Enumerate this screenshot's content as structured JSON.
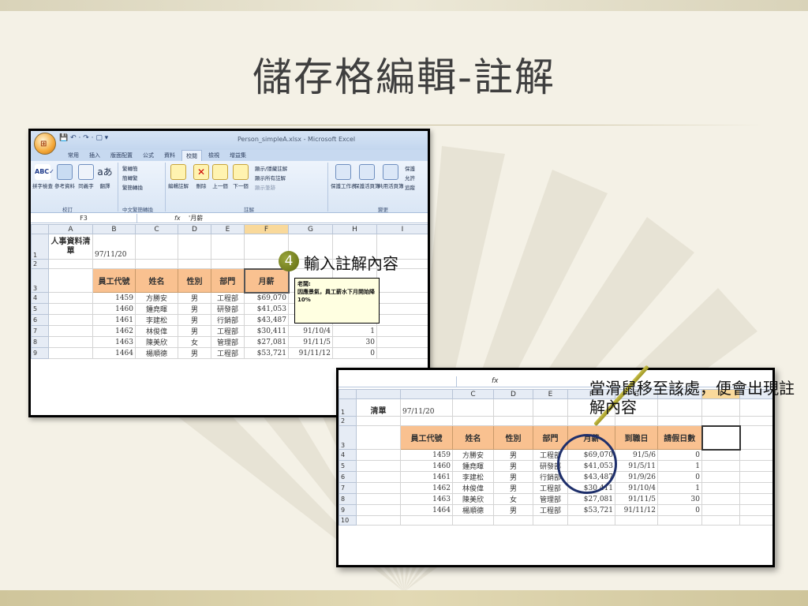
{
  "slide": {
    "title": "儲存格編輯-註解",
    "step_number": "4",
    "step_text": "輸入註解內容",
    "callout_text": "當滑鼠移至該處，便會出現註解內容"
  },
  "excel1": {
    "window_title": "Person_simpleA.xlsx - Microsoft Excel",
    "tabs": [
      "常用",
      "插入",
      "版面配置",
      "公式",
      "資料",
      "校閱",
      "檢視",
      "增益集"
    ],
    "active_tab": "校閱",
    "ribbon": {
      "spelling": "拼字檢查",
      "research": "參考資料",
      "thesaurus": "同義字",
      "translate": "翻譯",
      "trad_to_simp": "繁轉簡",
      "simp_to_trad": "簡轉繁",
      "convert": "繁簡轉換",
      "new_comment": "編輯註解",
      "delete": "刪除",
      "previous": "上一個",
      "next": "下一個",
      "show_hide": "顯示/隱藏註解",
      "show_all": "顯示所有註解",
      "show_ink": "顯示筆跡",
      "protect_sheet": "保護工作表",
      "protect_workbook": "保護活頁簿",
      "share_workbook": "共用活頁簿",
      "protect_share": "保護",
      "allow_users": "允許",
      "track": "追蹤",
      "group_proofing": "校訂",
      "group_chinese": "中文繁簡轉換",
      "group_comments": "註解",
      "group_changes": "變更"
    },
    "name_box": "F3",
    "formula": "'月薪",
    "comment": {
      "author": "老闆:",
      "text": "因應景氣，員工薪水下月開始降10%"
    }
  },
  "sheet": {
    "columns": [
      "A",
      "B",
      "C",
      "D",
      "E",
      "F",
      "G",
      "H",
      "I"
    ],
    "title_a1": "人事資料清單",
    "title_a1_short": "清單",
    "date_b1": "97/11/20",
    "headers": [
      "員工代號",
      "姓名",
      "性別",
      "部門",
      "月薪",
      "到職日",
      "請假日數"
    ],
    "rows": [
      [
        "1459",
        "方勝安",
        "男",
        "工程部",
        "$69,070",
        "91/5/6",
        "0"
      ],
      [
        "1460",
        "鍾堯暉",
        "男",
        "研發部",
        "$41,053",
        "91/5/11",
        "1"
      ],
      [
        "1461",
        "李建松",
        "男",
        "行銷部",
        "$43,487",
        "91/9/26",
        "0"
      ],
      [
        "1462",
        "林俊偉",
        "男",
        "工程部",
        "$30,411",
        "91/10/4",
        "1"
      ],
      [
        "1463",
        "陳美欣",
        "女",
        "管理部",
        "$27,081",
        "91/11/5",
        "30"
      ],
      [
        "1464",
        "楊順德",
        "男",
        "工程部",
        "$53,721",
        "91/11/12",
        "0"
      ]
    ],
    "row_numbers": [
      "1",
      "2",
      "3",
      "4",
      "5",
      "6",
      "7",
      "8",
      "9",
      "10"
    ],
    "fx": "fx"
  }
}
